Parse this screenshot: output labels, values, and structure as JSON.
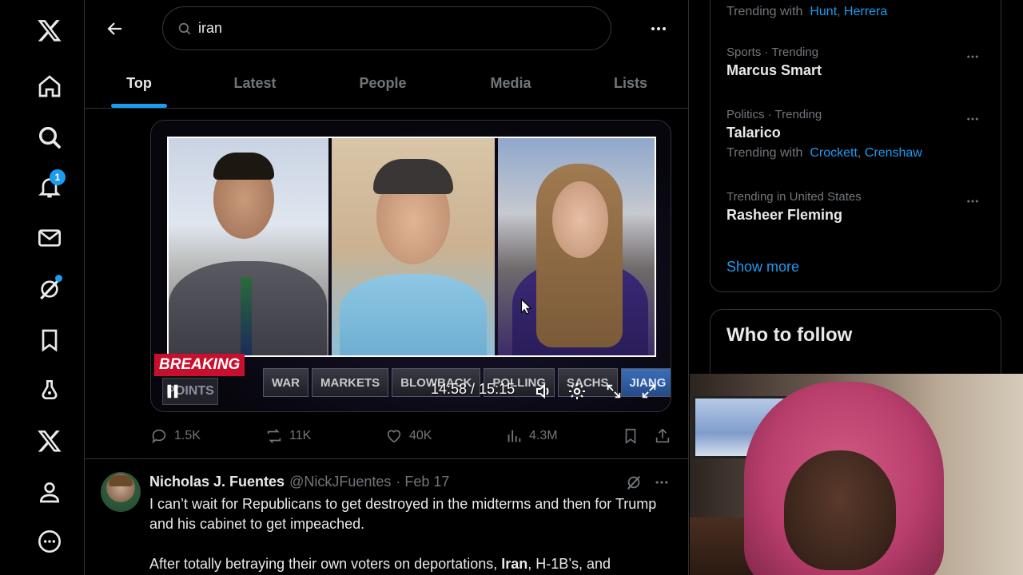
{
  "search": {
    "value": "iran",
    "placeholder": "Search"
  },
  "tabs": [
    {
      "label": "Top"
    },
    {
      "label": "Latest"
    },
    {
      "label": "People"
    },
    {
      "label": "Media"
    },
    {
      "label": "Lists"
    }
  ],
  "nav": {
    "notifications_badge": "1"
  },
  "video": {
    "breaking_label": "BREAKING",
    "points_label": "POINTS",
    "ticker": [
      "WAR",
      "MARKETS",
      "BLOWBACK",
      "POLLING",
      "SACHS",
      "JIANG"
    ],
    "time": "14:58 / 15:15"
  },
  "tweet1": {
    "replies": "1.5K",
    "reposts": "11K",
    "likes": "40K",
    "views": "4.3M"
  },
  "tweet2": {
    "name": "Nicholas J. Fuentes",
    "handle": "@NickJFuentes",
    "date": "· Feb 17",
    "para1": "I can’t wait for Republicans to get destroyed in the midterms and then for Trump and his cabinet to get impeached.",
    "para2_before": "After totally betraying their own voters on deportations, ",
    "para2_bold": "Iran",
    "para2_after": ", H-1B’s, and"
  },
  "trends": {
    "top_with_label": "Trending with",
    "top_links": [
      "Hunt",
      "Herrera"
    ],
    "items": [
      {
        "meta": "Sports · Trending",
        "title": "Marcus Smart"
      },
      {
        "meta": "Politics · Trending",
        "title": "Talarico",
        "with_label": "Trending with",
        "links": [
          "Crockett",
          "Crenshaw"
        ]
      },
      {
        "meta": "Trending in United States",
        "title": "Rasheer Fleming"
      }
    ],
    "show_more": "Show more"
  },
  "who_to_follow": {
    "title": "Who to follow"
  },
  "colors": {
    "accent": "#1d9bf0",
    "background": "#000000",
    "border": "#2f3336",
    "muted": "#71767b"
  }
}
